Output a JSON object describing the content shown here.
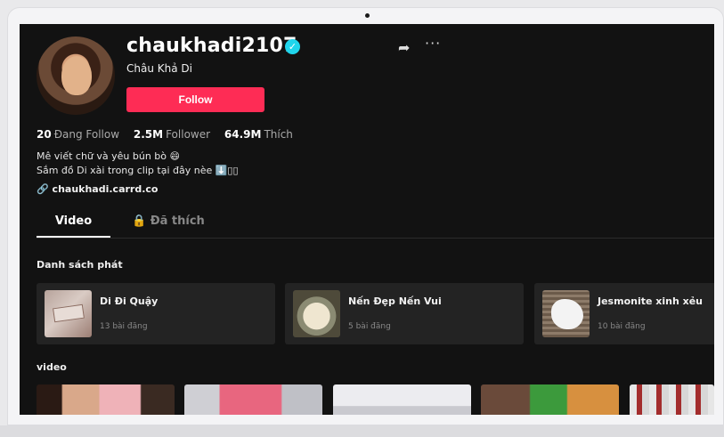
{
  "profile": {
    "username": "chaukhadi2107",
    "display_name": "Châu Khả Di",
    "follow_label": "Follow",
    "stats": [
      {
        "value": "20",
        "label": "Đang Follow"
      },
      {
        "value": "2.5M",
        "label": "Follower"
      },
      {
        "value": "64.9M",
        "label": "Thích"
      }
    ],
    "bio_line1": "Mê viết chữ và yêu bún bò 😄",
    "bio_line2": "Sắm đồ Di xài trong clip tại đây nèe ⬇️▯▯",
    "link": "chaukhadi.carrd.co"
  },
  "tabs": [
    {
      "label": "Video"
    },
    {
      "label": "Đã thích"
    }
  ],
  "playlists": {
    "heading": "Danh sách phát",
    "items": [
      {
        "title": "Di Đi Quậy",
        "count": "13 bài đăng"
      },
      {
        "title": "Nến Đẹp Nến Vui",
        "count": "5 bài đăng"
      },
      {
        "title": "Jesmonite xinh xẻu",
        "count": "10 bài đăng"
      }
    ]
  },
  "videos": {
    "heading": "video"
  },
  "icons": {
    "verified": "verified-badge-icon",
    "share": "share-icon",
    "more": "more-icon",
    "link": "link-icon",
    "lock": "lock-icon"
  },
  "colors": {
    "follow_button": "#fe2c55",
    "verified": "#20d5ec",
    "background": "#121212"
  }
}
